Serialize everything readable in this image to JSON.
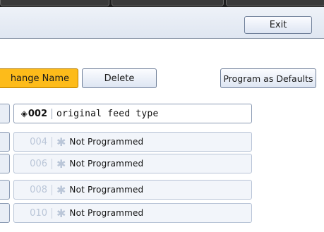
{
  "header": {
    "exit_label": "Exit"
  },
  "toolbar": {
    "change_name_label": "hange Name",
    "delete_label": "Delete",
    "program_defaults_label": "Program as Defaults"
  },
  "programs": [
    {
      "number": "002",
      "label": "original feed type",
      "registered": true
    },
    {
      "number": "004",
      "label": "Not Programmed",
      "registered": false
    },
    {
      "number": "006",
      "label": "Not Programmed",
      "registered": false
    },
    {
      "number": "008",
      "label": "Not Programmed",
      "registered": false
    },
    {
      "number": "010",
      "label": "Not Programmed",
      "registered": false
    }
  ],
  "icons": {
    "registered_marker": "diamond-arrow-icon",
    "unprogrammed_marker": "asterisk-icon"
  },
  "colors": {
    "selected_button": "#fdbb1a",
    "header_bg": "#dfe6f1",
    "disabled_text": "#bac6d8"
  }
}
